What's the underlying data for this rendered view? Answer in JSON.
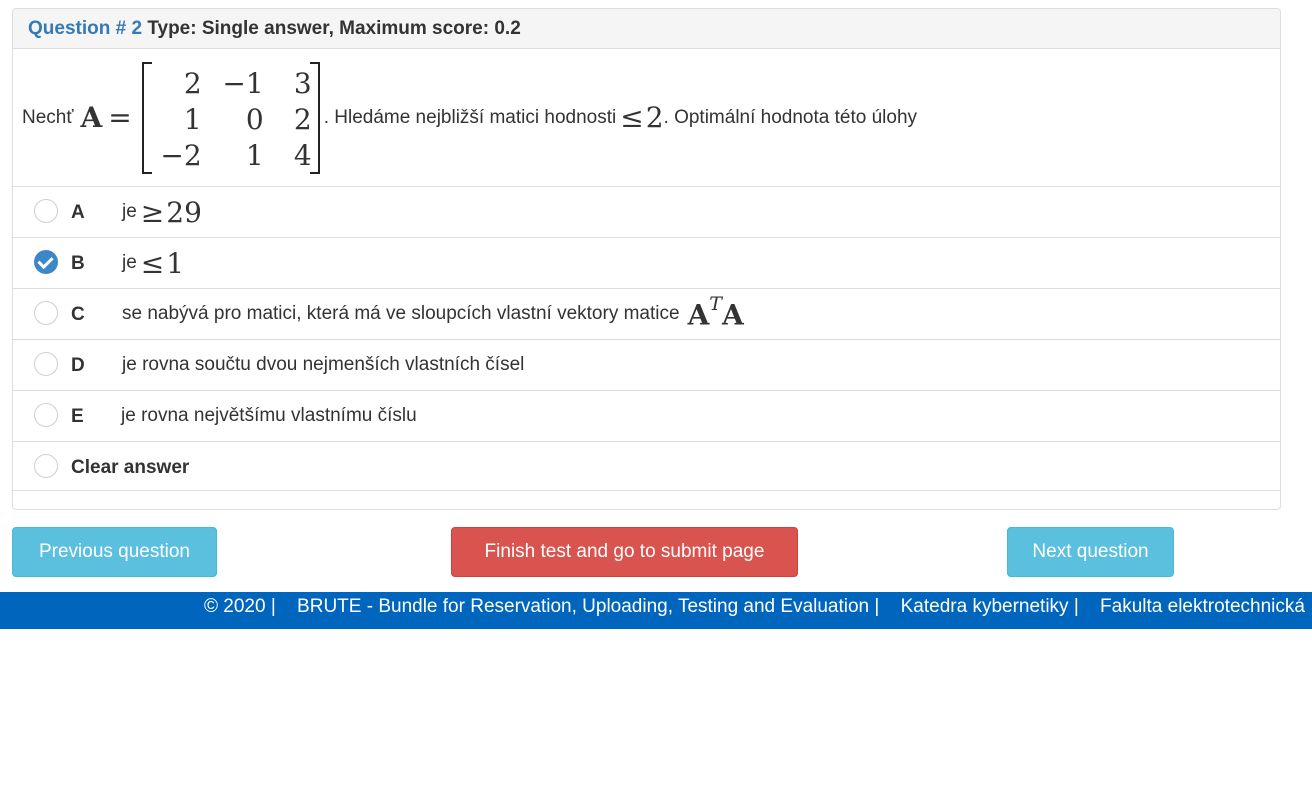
{
  "question": {
    "number_label": "Question # 2",
    "type_label": "Type: Single answer, Maximum score: 0.2",
    "text_prefix": "Nechť",
    "matrix_symbol": "A",
    "equals": "=",
    "matrix": [
      [
        "2",
        "−1",
        "3"
      ],
      [
        "1",
        "0",
        "2"
      ],
      [
        "−2",
        "1",
        "4"
      ]
    ],
    "text_middle": ". Hledáme nejbližší matici hodnosti",
    "rank_relation": "≤",
    "rank_value": "2",
    "text_suffix": ". Optimální hodnota této úlohy"
  },
  "answers": [
    {
      "letter": "A",
      "text": "je",
      "relation": "≥",
      "value": "29",
      "checked": false
    },
    {
      "letter": "B",
      "text": "je",
      "relation": "≤",
      "value": "1",
      "checked": true
    },
    {
      "letter": "C",
      "text": "se nabývá pro matici, která má ve sloupcích vlastní vektory matice",
      "math_base": "A",
      "math_sup": "T",
      "math_tail": "A",
      "checked": false
    },
    {
      "letter": "D",
      "text": "je rovna součtu dvou nejmenších vlastních čísel",
      "checked": false
    },
    {
      "letter": "E",
      "text": "je rovna největšímu vlastnímu číslu",
      "checked": false
    }
  ],
  "clear_answer_label": "Clear answer",
  "buttons": {
    "previous": "Previous question",
    "finish": "Finish test and go to submit page",
    "next": "Next question"
  },
  "footer": {
    "copyright": "© 2020 |",
    "app": "BRUTE - Bundle for Reservation, Uploading, Testing and Evaluation |",
    "department": "Katedra kybernetiky |",
    "faculty": "Fakulta elektrotechnická"
  },
  "colors": {
    "question_number": "#337ab7",
    "checked_radio": "#3d86c8",
    "info_button": "#5bc0de",
    "danger_button": "#d9534f",
    "footer_bar": "#0065bd"
  }
}
